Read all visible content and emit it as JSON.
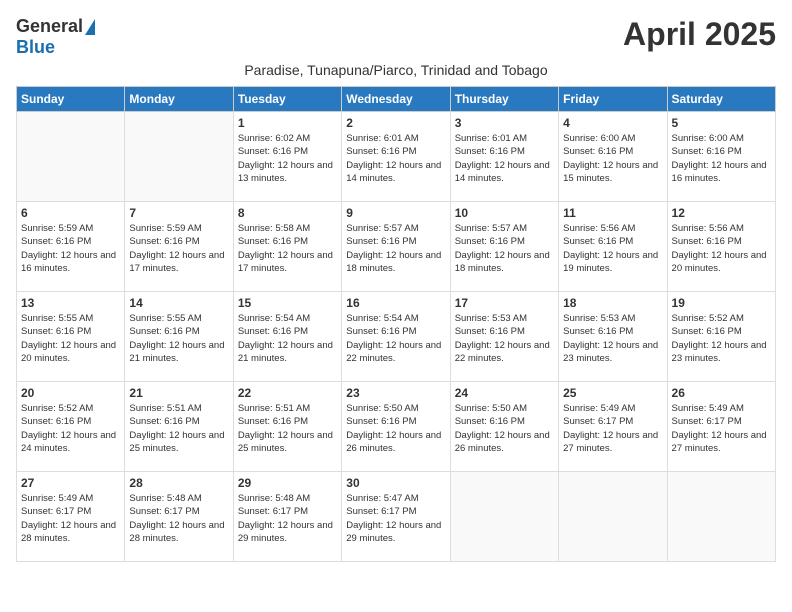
{
  "logo": {
    "general": "General",
    "blue": "Blue"
  },
  "title": "April 2025",
  "subtitle": "Paradise, Tunapuna/Piarco, Trinidad and Tobago",
  "days_header": [
    "Sunday",
    "Monday",
    "Tuesday",
    "Wednesday",
    "Thursday",
    "Friday",
    "Saturday"
  ],
  "weeks": [
    [
      {
        "num": "",
        "info": ""
      },
      {
        "num": "",
        "info": ""
      },
      {
        "num": "1",
        "info": "Sunrise: 6:02 AM\nSunset: 6:16 PM\nDaylight: 12 hours and 13 minutes."
      },
      {
        "num": "2",
        "info": "Sunrise: 6:01 AM\nSunset: 6:16 PM\nDaylight: 12 hours and 14 minutes."
      },
      {
        "num": "3",
        "info": "Sunrise: 6:01 AM\nSunset: 6:16 PM\nDaylight: 12 hours and 14 minutes."
      },
      {
        "num": "4",
        "info": "Sunrise: 6:00 AM\nSunset: 6:16 PM\nDaylight: 12 hours and 15 minutes."
      },
      {
        "num": "5",
        "info": "Sunrise: 6:00 AM\nSunset: 6:16 PM\nDaylight: 12 hours and 16 minutes."
      }
    ],
    [
      {
        "num": "6",
        "info": "Sunrise: 5:59 AM\nSunset: 6:16 PM\nDaylight: 12 hours and 16 minutes."
      },
      {
        "num": "7",
        "info": "Sunrise: 5:59 AM\nSunset: 6:16 PM\nDaylight: 12 hours and 17 minutes."
      },
      {
        "num": "8",
        "info": "Sunrise: 5:58 AM\nSunset: 6:16 PM\nDaylight: 12 hours and 17 minutes."
      },
      {
        "num": "9",
        "info": "Sunrise: 5:57 AM\nSunset: 6:16 PM\nDaylight: 12 hours and 18 minutes."
      },
      {
        "num": "10",
        "info": "Sunrise: 5:57 AM\nSunset: 6:16 PM\nDaylight: 12 hours and 18 minutes."
      },
      {
        "num": "11",
        "info": "Sunrise: 5:56 AM\nSunset: 6:16 PM\nDaylight: 12 hours and 19 minutes."
      },
      {
        "num": "12",
        "info": "Sunrise: 5:56 AM\nSunset: 6:16 PM\nDaylight: 12 hours and 20 minutes."
      }
    ],
    [
      {
        "num": "13",
        "info": "Sunrise: 5:55 AM\nSunset: 6:16 PM\nDaylight: 12 hours and 20 minutes."
      },
      {
        "num": "14",
        "info": "Sunrise: 5:55 AM\nSunset: 6:16 PM\nDaylight: 12 hours and 21 minutes."
      },
      {
        "num": "15",
        "info": "Sunrise: 5:54 AM\nSunset: 6:16 PM\nDaylight: 12 hours and 21 minutes."
      },
      {
        "num": "16",
        "info": "Sunrise: 5:54 AM\nSunset: 6:16 PM\nDaylight: 12 hours and 22 minutes."
      },
      {
        "num": "17",
        "info": "Sunrise: 5:53 AM\nSunset: 6:16 PM\nDaylight: 12 hours and 22 minutes."
      },
      {
        "num": "18",
        "info": "Sunrise: 5:53 AM\nSunset: 6:16 PM\nDaylight: 12 hours and 23 minutes."
      },
      {
        "num": "19",
        "info": "Sunrise: 5:52 AM\nSunset: 6:16 PM\nDaylight: 12 hours and 23 minutes."
      }
    ],
    [
      {
        "num": "20",
        "info": "Sunrise: 5:52 AM\nSunset: 6:16 PM\nDaylight: 12 hours and 24 minutes."
      },
      {
        "num": "21",
        "info": "Sunrise: 5:51 AM\nSunset: 6:16 PM\nDaylight: 12 hours and 25 minutes."
      },
      {
        "num": "22",
        "info": "Sunrise: 5:51 AM\nSunset: 6:16 PM\nDaylight: 12 hours and 25 minutes."
      },
      {
        "num": "23",
        "info": "Sunrise: 5:50 AM\nSunset: 6:16 PM\nDaylight: 12 hours and 26 minutes."
      },
      {
        "num": "24",
        "info": "Sunrise: 5:50 AM\nSunset: 6:16 PM\nDaylight: 12 hours and 26 minutes."
      },
      {
        "num": "25",
        "info": "Sunrise: 5:49 AM\nSunset: 6:17 PM\nDaylight: 12 hours and 27 minutes."
      },
      {
        "num": "26",
        "info": "Sunrise: 5:49 AM\nSunset: 6:17 PM\nDaylight: 12 hours and 27 minutes."
      }
    ],
    [
      {
        "num": "27",
        "info": "Sunrise: 5:49 AM\nSunset: 6:17 PM\nDaylight: 12 hours and 28 minutes."
      },
      {
        "num": "28",
        "info": "Sunrise: 5:48 AM\nSunset: 6:17 PM\nDaylight: 12 hours and 28 minutes."
      },
      {
        "num": "29",
        "info": "Sunrise: 5:48 AM\nSunset: 6:17 PM\nDaylight: 12 hours and 29 minutes."
      },
      {
        "num": "30",
        "info": "Sunrise: 5:47 AM\nSunset: 6:17 PM\nDaylight: 12 hours and 29 minutes."
      },
      {
        "num": "",
        "info": ""
      },
      {
        "num": "",
        "info": ""
      },
      {
        "num": "",
        "info": ""
      }
    ]
  ]
}
